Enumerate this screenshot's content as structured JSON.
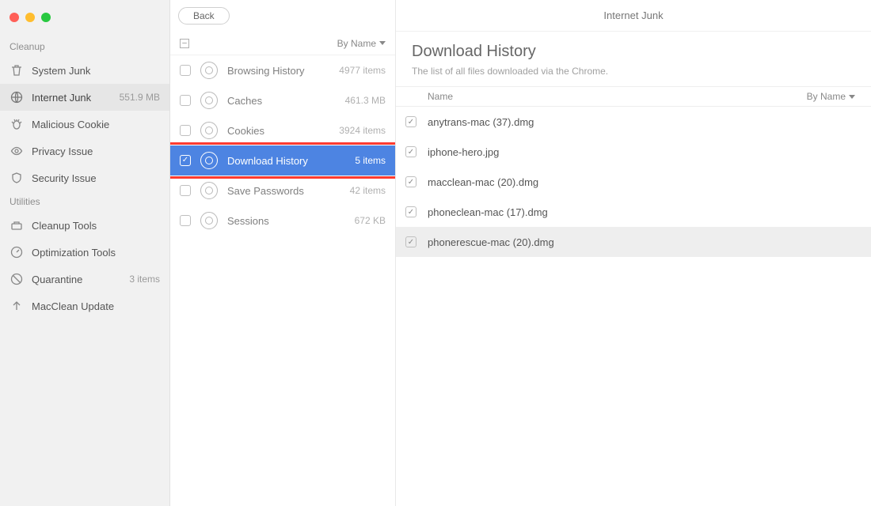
{
  "header": {
    "back": "Back",
    "title": "Internet Junk"
  },
  "sidebar": {
    "sections": {
      "cleanup": "Cleanup",
      "utilities": "Utilities"
    },
    "items": [
      {
        "icon": "trash-icon",
        "label": "System Junk",
        "meta": ""
      },
      {
        "icon": "globe-icon",
        "label": "Internet Junk",
        "meta": "551.9 MB",
        "selected": true
      },
      {
        "icon": "bug-icon",
        "label": "Malicious Cookie",
        "meta": ""
      },
      {
        "icon": "eye-icon",
        "label": "Privacy Issue",
        "meta": ""
      },
      {
        "icon": "shield-icon",
        "label": "Security Issue",
        "meta": ""
      },
      {
        "icon": "toolbox-icon",
        "label": "Cleanup Tools",
        "meta": ""
      },
      {
        "icon": "gauge-icon",
        "label": "Optimization Tools",
        "meta": ""
      },
      {
        "icon": "quarantine-icon",
        "label": "Quarantine",
        "meta": "3 items"
      },
      {
        "icon": "update-icon",
        "label": "MacClean Update",
        "meta": ""
      }
    ]
  },
  "middleSort": "By Name",
  "categories": [
    {
      "label": "Browsing History",
      "meta": "4977 items"
    },
    {
      "label": "Caches",
      "meta": "461.3 MB"
    },
    {
      "label": "Cookies",
      "meta": "3924 items"
    },
    {
      "label": "Download History",
      "meta": "5 items",
      "active": true,
      "checked": true
    },
    {
      "label": "Save Passwords",
      "meta": "42 items"
    },
    {
      "label": "Sessions",
      "meta": "672 KB"
    }
  ],
  "detail": {
    "title": "Download History",
    "subtitle": "The list of all files downloaded via the Chrome.",
    "tableHeader": {
      "name": "Name",
      "sort": "By Name"
    }
  },
  "files": [
    {
      "name": "anytrans-mac (37).dmg"
    },
    {
      "name": "iphone-hero.jpg"
    },
    {
      "name": "macclean-mac (20).dmg"
    },
    {
      "name": "phoneclean-mac (17).dmg"
    },
    {
      "name": "phonerescue-mac (20).dmg",
      "alt": true
    }
  ]
}
